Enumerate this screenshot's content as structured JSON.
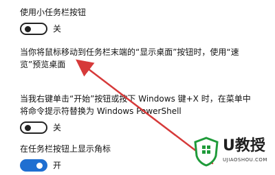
{
  "settings": {
    "small_buttons": {
      "title": "使用小任务栏按钮",
      "state": "关"
    },
    "peek_text": "当你将鼠标移动到任务栏末端的“显示桌面”按钮时，使用“速览”预览桌面",
    "powershell": {
      "title": "当我右键单击“开始”按钮或按下 Windows 键+X 时，在菜单中将命令提示符替换为 Windows PowerShell",
      "state": "关"
    },
    "badges": {
      "title": "在任务栏按钮上显示角标",
      "state": "开"
    }
  },
  "watermark": {
    "title": "U教授",
    "subtitle": "UJIAOSHOU.COM"
  },
  "colors": {
    "annotation_arrow": "#d63a3a",
    "toggle_on": "#1f6fd1",
    "toggle_off": "#222222",
    "watermark_green": "#1f9b3a"
  }
}
